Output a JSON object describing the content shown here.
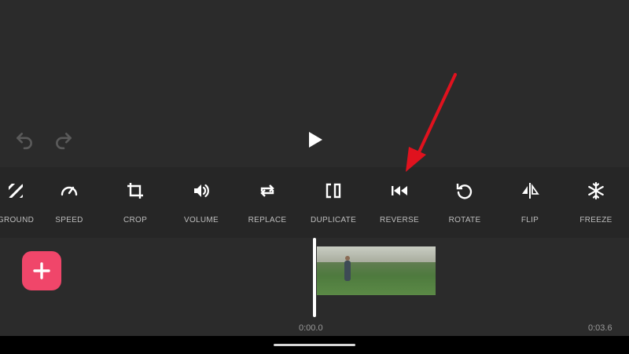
{
  "preview": {
    "undo_icon": "undo-icon",
    "redo_icon": "redo-icon",
    "play_icon": "play-icon"
  },
  "toolbar": {
    "items": [
      {
        "label": "GROUND",
        "icon": "background-icon"
      },
      {
        "label": "SPEED",
        "icon": "speed-gauge-icon"
      },
      {
        "label": "CROP",
        "icon": "crop-icon"
      },
      {
        "label": "VOLUME",
        "icon": "volume-icon"
      },
      {
        "label": "REPLACE",
        "icon": "replace-icon"
      },
      {
        "label": "DUPLICATE",
        "icon": "duplicate-icon"
      },
      {
        "label": "REVERSE",
        "icon": "reverse-icon"
      },
      {
        "label": "ROTATE",
        "icon": "rotate-icon"
      },
      {
        "label": "FLIP",
        "icon": "flip-icon"
      },
      {
        "label": "FREEZE",
        "icon": "snowflake-icon"
      }
    ]
  },
  "timeline": {
    "add_icon": "plus-icon",
    "start_time": "0:00.0",
    "end_time": "0:03.6"
  },
  "colors": {
    "accent": "#f0466a",
    "annotation_arrow": "#e0121e",
    "background": "#2b2b2b",
    "toolbar_bg": "#262626"
  }
}
